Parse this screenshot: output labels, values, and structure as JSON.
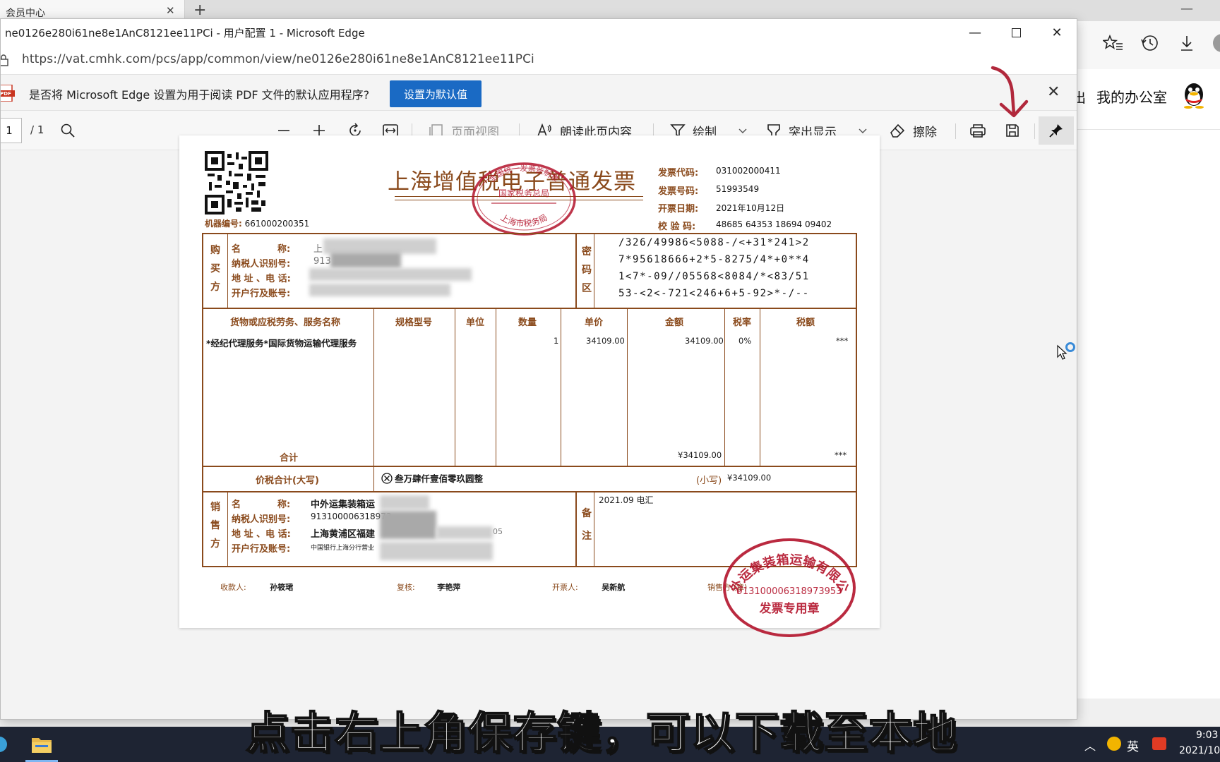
{
  "background_browser": {
    "tab_title": "会员中心",
    "tab_close": "✕",
    "new_tab": "+",
    "page_office_cut": "出",
    "page_office": "我的办公室"
  },
  "window": {
    "title": "ne0126e280i61ne8e1AnC8121ee11PCi - 用户配置 1 - Microsoft Edge",
    "url": "https://vat.cmhk.com/pcs/app/common/view/ne0126e280i61ne8e1AnC8121ee11PCi"
  },
  "infobar": {
    "message": "是否将 Microsoft Edge 设置为用于阅读 PDF 文件的默认应用程序?",
    "button": "设置为默认值"
  },
  "pdf_toolbar": {
    "page_current": "1",
    "page_total": "/ 1",
    "page_view": "页面视图",
    "read_aloud": "朗读此页内容",
    "draw": "绘制",
    "highlight": "突出显示",
    "erase": "擦除"
  },
  "invoice": {
    "title": "上海增值税电子普通发票",
    "machine_no_label": "机器编号:",
    "machine_no": "661000200351",
    "code_label": "发票代码:",
    "code": "031002000411",
    "number_label": "发票号码:",
    "number": "51993549",
    "date_label": "开票日期:",
    "date": "2021年10月12日",
    "check_label": "校 验 码:",
    "check_code": "48685 64353 18694 09402",
    "buyer_side": [
      "购",
      "买",
      "方"
    ],
    "buyer_labels": [
      "名　　　　称:",
      "纳税人识别号:",
      "地 址 、电 话:",
      "开户行及账号:"
    ],
    "buyer_visible": [
      "上",
      "913",
      "",
      ""
    ],
    "cipher_side": [
      "密",
      "码",
      "区"
    ],
    "cipher": [
      "/326/49986<5088-/<+31*241>2",
      "7*95618666+2*5-8275/4*+0**4",
      "1<7*-09//05568<8084/*<83/51",
      "53-<2<-721<246+6+5-92>*-/--"
    ],
    "item_headers": [
      "货物或应税劳务、服务名称",
      "规格型号",
      "单位",
      "数量",
      "单价",
      "金额",
      "税率",
      "税额"
    ],
    "item": {
      "name": "*经纪代理服务*国际货物运输代理服务",
      "qty": "1",
      "unit_price": "34109.00",
      "amount": "34109.00",
      "rate": "0%",
      "tax": "***"
    },
    "subtotal_label": "合计",
    "subtotal_amount": "¥34109.00",
    "subtotal_tax": "***",
    "total_caps_label": "价税合计(大写)",
    "total_caps": "叁万肆仟壹佰零玖圆整",
    "total_small_label": "(小写)",
    "total_small": "¥34109.00",
    "seller_side": [
      "销",
      "售",
      "方"
    ],
    "seller_labels": [
      "名　　　　称:",
      "纳税人识别号:",
      "地 址 、电 话:",
      "开户行及账号:"
    ],
    "seller_visible": [
      "中外运集装箱运",
      "913100006318973",
      "上海黄浦区福建",
      "中国银行上海分行营业"
    ],
    "seller_phone_tail": "05",
    "remark_side": [
      "备",
      "注"
    ],
    "remark": "2021.09 电汇",
    "payee_label": "收款人:",
    "payee": "孙筱珺",
    "reviewer_label": "复核:",
    "reviewer": "李艳萍",
    "issuer_label": "开票人:",
    "issuer": "吴新航",
    "seller_sign_label": "销售方:(章)",
    "tax_seal_top": "全国统一发票监制章",
    "tax_seal_mid": "国家税务总局",
    "tax_seal_bottom": "上海市税务局",
    "company_seal_name": "中外运集装箱运输有限公司",
    "company_seal_id": "913100006318973953",
    "company_seal_bottom": "发票专用章"
  },
  "subtitle": "点击右上角保存键，可以下载至本地",
  "taskbar": {
    "ime": "英",
    "time": "9:03",
    "date": "2021/10"
  },
  "colors": {
    "invoice_brown": "#8a4a1c",
    "seal_red": "#b3132b",
    "edge_blue": "#1a6ac4",
    "taskbar": "#1e2433"
  }
}
